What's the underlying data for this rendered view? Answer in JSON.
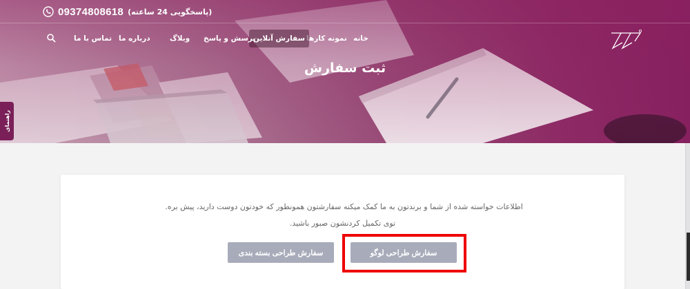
{
  "topbar": {
    "phone_number": "09374808618",
    "phone_note": "(پاسخگویی 24 ساعته)"
  },
  "nav": {
    "items": [
      {
        "label": "خانه"
      },
      {
        "label": "نمونه کارها"
      },
      {
        "label": "سفارش آنلاین",
        "active": true
      },
      {
        "label": "پرسش و پاسخ"
      },
      {
        "label": "وبلاگ"
      },
      {
        "label": "درباره ما"
      },
      {
        "label": "تماس با ما"
      }
    ]
  },
  "hero": {
    "title": "ثبت سفارش"
  },
  "side_tab": {
    "label": "راهنمای"
  },
  "card": {
    "line1": "اطلاعات خواسته شده از شما و برندتون به ما کمک میکنه سفارشتون همونطور که خودتون دوست دارید، پیش بره.",
    "line2": "توی تکمیل کردنشون صبور باشید.",
    "buttons": {
      "logo": "سفارش طراحی لوگو",
      "package": "سفارش طراحی بسته بندی"
    }
  },
  "colors": {
    "brand": "#8e2c66",
    "button": "#a8acba",
    "highlight": "#ee0000"
  }
}
